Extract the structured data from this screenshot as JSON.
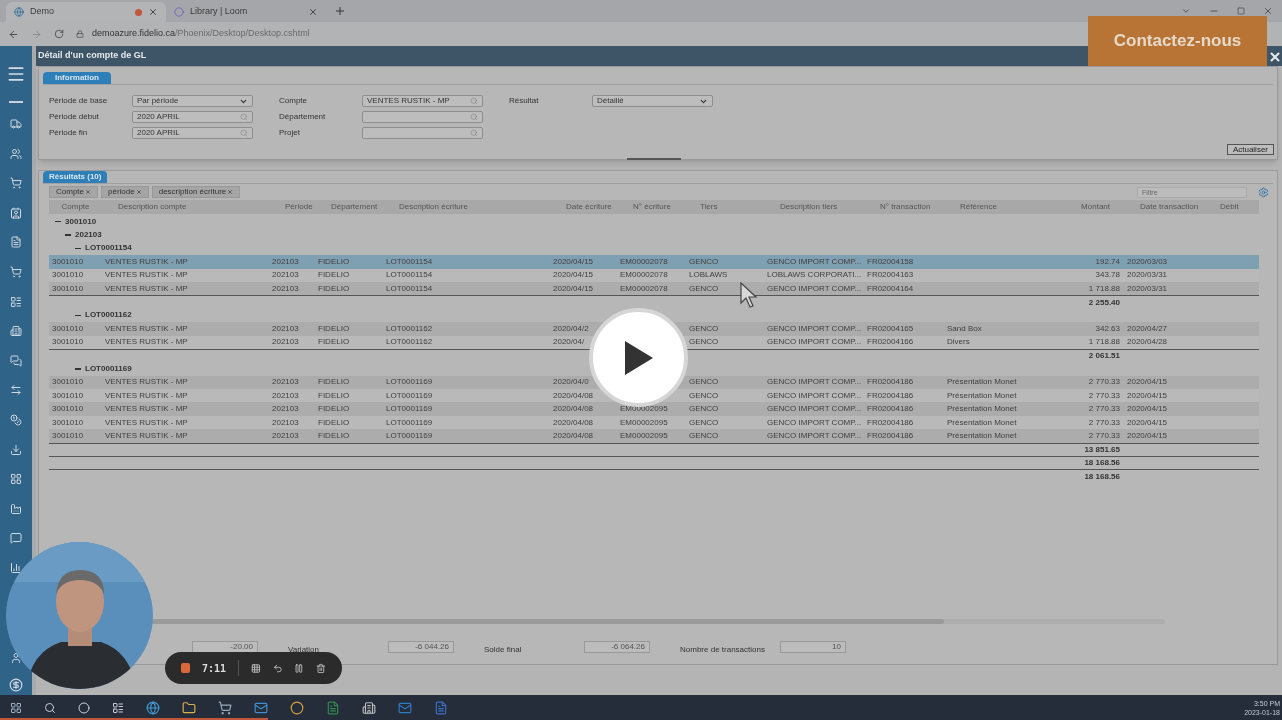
{
  "browser": {
    "tabs": [
      {
        "title": "Demo",
        "selected": true,
        "recording": true
      },
      {
        "title": "Library | Loom",
        "selected": false,
        "recording": false
      }
    ],
    "url_host": "demoazure.fidelio.ca",
    "url_path": "/Phoenix/Desktop/Desktop.cshtml"
  },
  "contact_button": "Contactez-nous",
  "window": {
    "title": "Détail d'un compte de GL"
  },
  "info": {
    "tab": "Information",
    "columns": [
      [
        {
          "label": "Période de base",
          "value": "Par période",
          "kind": "select"
        },
        {
          "label": "Période début",
          "value": "2020 APRIL",
          "kind": "lookup"
        },
        {
          "label": "Période fin",
          "value": "2020 APRIL",
          "kind": "lookup"
        }
      ],
      [
        {
          "label": "Compte",
          "value": "VENTES RUSTIK - MP",
          "kind": "lookup"
        },
        {
          "label": "Département",
          "kind": "lookup"
        },
        {
          "label": "Projet",
          "kind": "lookup"
        }
      ],
      [
        {
          "label": "Résultat",
          "value": "Détaillé",
          "kind": "select"
        }
      ]
    ],
    "refresh_button": "Actualiser"
  },
  "results": {
    "tab": "Résultats (10)",
    "chips": [
      "Compte",
      "période",
      "description écriture"
    ],
    "filter_placeholder": "Filtre",
    "columns": [
      "Compte",
      "Description compte",
      "Période",
      "Département",
      "Description écriture",
      "Date écriture",
      "N° écriture",
      "Tiers",
      "Description tiers",
      "N° transaction",
      "Référence",
      "Montant",
      "Date transaction",
      "Débit"
    ],
    "groups": [
      {
        "label": "3001010",
        "expanded": true,
        "total": "18 168.56",
        "children": [
          {
            "label": "202103",
            "expanded": true,
            "total": "18 168.56",
            "children": [
              {
                "label": "LOT0001154",
                "expanded": true,
                "total": "2 255.40",
                "rows": [
                  {
                    "selected": true,
                    "cells": [
                      "3001010",
                      "VENTES RUSTIK - MP",
                      "202103",
                      "FIDELIO",
                      "LOT0001154",
                      "2020/04/15",
                      "EM00002078",
                      "GENCO",
                      "GENCO IMPORT COMP...",
                      "FR02004158",
                      null,
                      "192.74",
                      "2020/03/03"
                    ]
                  },
                  {
                    "selected": false,
                    "cells": [
                      "3001010",
                      "VENTES RUSTIK - MP",
                      "202103",
                      "FIDELIO",
                      "LOT0001154",
                      "2020/04/15",
                      "EM00002078",
                      "LOBLAWS",
                      "LOBLAWS CORPORATI...",
                      "FR02004163",
                      null,
                      "343.78",
                      "2020/03/31"
                    ]
                  },
                  {
                    "selected": false,
                    "cells": [
                      "3001010",
                      "VENTES RUSTIK - MP",
                      "202103",
                      "FIDELIO",
                      "LOT0001154",
                      "2020/04/15",
                      "EM00002078",
                      "GENCO",
                      "GENCO IMPORT COMP...",
                      "FR02004164",
                      null,
                      "1 718.88",
                      "2020/03/31"
                    ]
                  }
                ]
              },
              {
                "label": "LOT0001162",
                "expanded": true,
                "total": "2 061.51",
                "rows": [
                  {
                    "selected": false,
                    "cells": [
                      "3001010",
                      "VENTES RUSTIK - MP",
                      "202103",
                      "FIDELIO",
                      "LOT0001162",
                      "2020/04/2",
                      null,
                      "GENCO",
                      "GENCO IMPORT COMP...",
                      "FR02004165",
                      "Sand Box",
                      "342.63",
                      "2020/04/27"
                    ]
                  },
                  {
                    "selected": false,
                    "cells": [
                      "3001010",
                      "VENTES RUSTIK - MP",
                      "202103",
                      "FIDELIO",
                      "LOT0001162",
                      "2020/04/",
                      null,
                      "GENCO",
                      "GENCO IMPORT COMP...",
                      "FR02004166",
                      "Divers",
                      "1 718.88",
                      "2020/04/28"
                    ]
                  }
                ]
              },
              {
                "label": "LOT0001169",
                "expanded": true,
                "total": "13 851.65",
                "rows": [
                  {
                    "selected": false,
                    "cells": [
                      "3001010",
                      "VENTES RUSTIK - MP",
                      "202103",
                      "FIDELIO",
                      "LOT0001169",
                      "2020/04/0",
                      null,
                      "GENCO",
                      "GENCO IMPORT COMP...",
                      "FR02004186",
                      "Présentation Monet",
                      "2 770.33",
                      "2020/04/15"
                    ]
                  },
                  {
                    "selected": false,
                    "cells": [
                      "3001010",
                      "VENTES RUSTIK - MP",
                      "202103",
                      "FIDELIO",
                      "LOT0001169",
                      "2020/04/08",
                      null,
                      "GENCO",
                      "GENCO IMPORT COMP...",
                      "FR02004186",
                      "Présentation Monet",
                      "2 770.33",
                      "2020/04/15"
                    ]
                  },
                  {
                    "selected": false,
                    "cells": [
                      "3001010",
                      "VENTES RUSTIK - MP",
                      "202103",
                      "FIDELIO",
                      "LOT0001169",
                      "2020/04/08",
                      "EM00002095",
                      "GENCO",
                      "GENCO IMPORT COMP...",
                      "FR02004186",
                      "Présentation Monet",
                      "2 770.33",
                      "2020/04/15"
                    ]
                  },
                  {
                    "selected": false,
                    "cells": [
                      "3001010",
                      "VENTES RUSTIK - MP",
                      "202103",
                      "FIDELIO",
                      "LOT0001169",
                      "2020/04/08",
                      "EM00002095",
                      "GENCO",
                      "GENCO IMPORT COMP...",
                      "FR02004186",
                      "Présentation Monet",
                      "2 770.33",
                      "2020/04/15"
                    ]
                  },
                  {
                    "selected": false,
                    "cells": [
                      "3001010",
                      "VENTES RUSTIK - MP",
                      "202103",
                      "FIDELIO",
                      "LOT0001169",
                      "2020/04/08",
                      "EM00002095",
                      "GENCO",
                      "GENCO IMPORT COMP...",
                      "FR02004186",
                      "Présentation Monet",
                      "2 770.33",
                      "2020/04/15"
                    ]
                  }
                ]
              }
            ]
          }
        ]
      }
    ],
    "summary": [
      {
        "value": "-20.00"
      },
      {
        "label": "Variation",
        "value": "-6 044.26"
      },
      {
        "label": "Solde final",
        "value": "-6 064.26"
      },
      {
        "label": "Nombre de transactions",
        "value": "10"
      }
    ]
  },
  "recorder": {
    "time": "7:11"
  },
  "taskbar": {
    "time": "3:50 PM",
    "date": "2023-01-18"
  }
}
